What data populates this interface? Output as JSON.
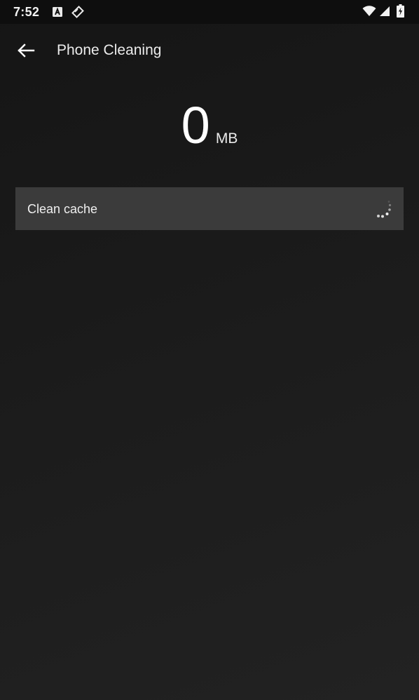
{
  "status_bar": {
    "time": "7:52",
    "notification_icons": [
      "a-box-icon",
      "tag-icon"
    ],
    "system_icons": [
      "wifi-icon",
      "cell-signal-icon",
      "battery-charging-icon"
    ]
  },
  "app_bar": {
    "back_icon": "arrow-left-icon",
    "title": "Phone Cleaning"
  },
  "cache_size": {
    "value": "0",
    "unit": "MB"
  },
  "actions": {
    "clean_cache_label": "Clean cache",
    "state_icon": "loading-spinner-icon"
  },
  "colors": {
    "background": "#1a1a1a",
    "status_bar": "#0e0e0e",
    "row_background": "#3b3b3b",
    "text": "#ffffff"
  }
}
